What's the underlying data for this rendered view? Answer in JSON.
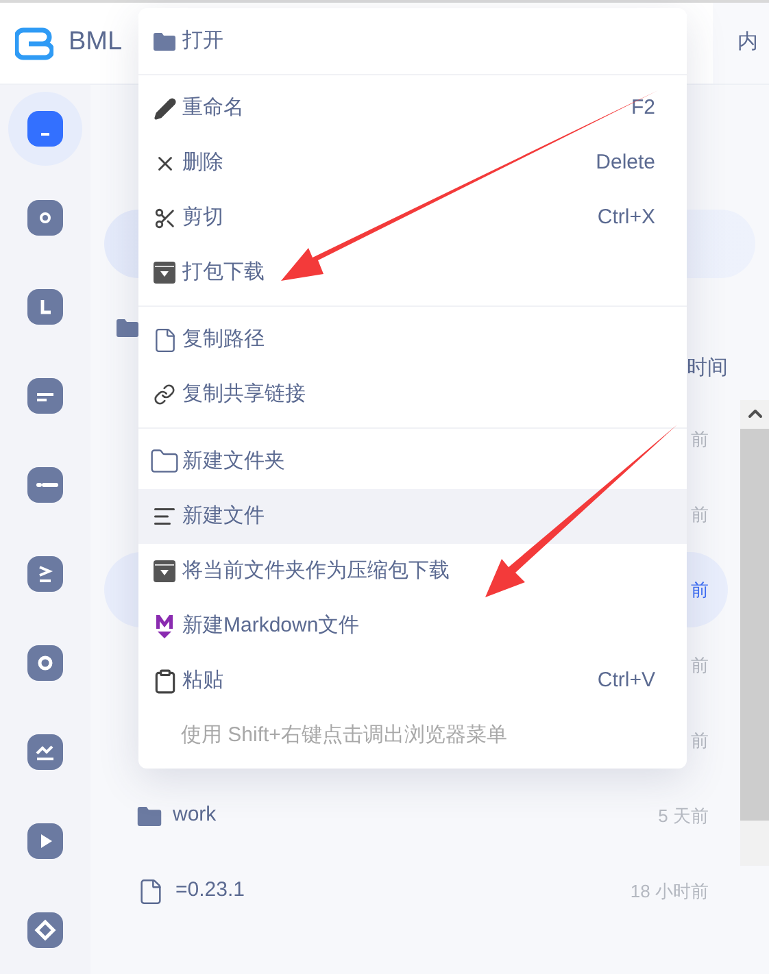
{
  "header": {
    "logo_text": "BML",
    "tab_label": "内"
  },
  "rail_items": [
    {
      "selected": true
    },
    {
      "selected": false
    },
    {
      "selected": false
    },
    {
      "selected": false
    },
    {
      "selected": false
    },
    {
      "selected": false
    },
    {
      "selected": false
    },
    {
      "selected": false
    },
    {
      "selected": false
    },
    {
      "selected": false
    }
  ],
  "file_list": {
    "column_header": "时间",
    "rows": [
      {
        "kind": "hidden",
        "time": "前",
        "selected": false
      },
      {
        "kind": "hidden",
        "time": "前",
        "selected": false
      },
      {
        "kind": "hidden",
        "time": "前",
        "selected": true
      },
      {
        "kind": "hidden",
        "time": "前",
        "selected": false
      },
      {
        "kind": "hidden",
        "time": "前",
        "selected": false
      },
      {
        "kind": "folder",
        "name": "work",
        "time": "5 天前",
        "selected": false
      },
      {
        "kind": "file",
        "name": "=0.23.1",
        "time": "18 小时前",
        "selected": false
      }
    ]
  },
  "context_menu": {
    "groups": [
      [
        {
          "kind": "folder",
          "label": "打开",
          "hovered": false
        }
      ],
      [
        {
          "kind": "pencil",
          "label": "重命名",
          "shortcut": "F2",
          "hovered": false
        },
        {
          "kind": "close",
          "label": "删除",
          "shortcut": "Delete",
          "hovered": false
        },
        {
          "kind": "scissors",
          "label": "剪切",
          "shortcut": "Ctrl+X",
          "hovered": false
        },
        {
          "kind": "archive",
          "label": "打包下载",
          "hovered": false
        }
      ],
      [
        {
          "kind": "file",
          "label": "复制路径",
          "hovered": false
        },
        {
          "kind": "link",
          "label": "复制共享链接",
          "hovered": false
        }
      ],
      [
        {
          "kind": "folder-outline",
          "label": "新建文件夹",
          "hovered": false
        },
        {
          "kind": "lines",
          "label": "新建文件",
          "hovered": true
        },
        {
          "kind": "archive",
          "label": "将当前文件夹作为压缩包下载",
          "hovered": false
        },
        {
          "kind": "markdown",
          "label": "新建Markdown文件",
          "hovered": false
        },
        {
          "kind": "clipboard",
          "label": "粘贴",
          "shortcut": "Ctrl+V",
          "hovered": false
        },
        {
          "kind": "hint",
          "label": "使用 Shift+右键点击调出浏览器菜单"
        }
      ]
    ]
  }
}
